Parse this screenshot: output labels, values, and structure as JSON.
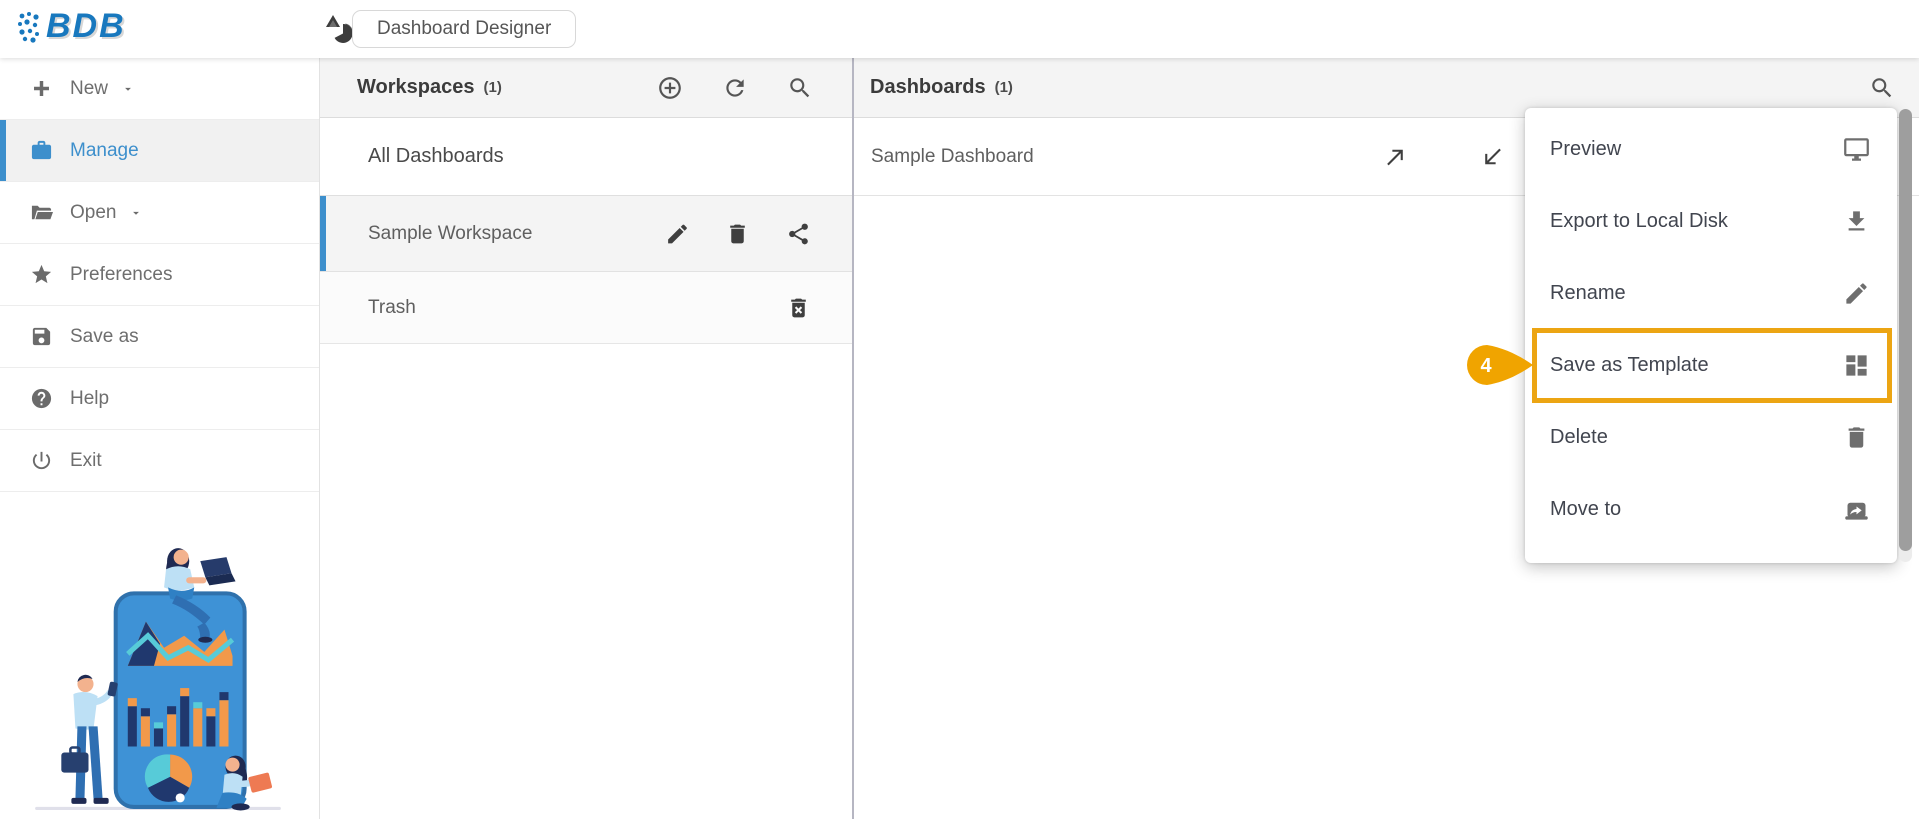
{
  "topbar": {
    "logo_text": "BDB",
    "app_title": "Dashboard Designer"
  },
  "sidebar": {
    "items": [
      {
        "label": "New",
        "has_dropdown": true,
        "active": false
      },
      {
        "label": "Manage",
        "has_dropdown": false,
        "active": true
      },
      {
        "label": "Open",
        "has_dropdown": true,
        "active": false
      },
      {
        "label": "Preferences",
        "has_dropdown": false,
        "active": false
      },
      {
        "label": "Save as",
        "has_dropdown": false,
        "active": false
      },
      {
        "label": "Help",
        "has_dropdown": false,
        "active": false
      },
      {
        "label": "Exit",
        "has_dropdown": false,
        "active": false
      }
    ]
  },
  "workspaces": {
    "title": "Workspaces",
    "count": "(1)",
    "header_icons": [
      "add-circle",
      "refresh",
      "search"
    ],
    "items": [
      {
        "label": "All Dashboards",
        "selected": false
      },
      {
        "label": "Sample Workspace",
        "selected": true,
        "actions": [
          "edit",
          "delete",
          "share"
        ]
      },
      {
        "label": "Trash",
        "selected": false,
        "actions": [
          "delete-forever"
        ]
      }
    ]
  },
  "dashboards": {
    "title": "Dashboards",
    "count": "(1)",
    "header_icons": [
      "search"
    ],
    "items": [
      {
        "label": "Sample Dashboard",
        "actions": [
          "open-in-new",
          "open-in-current"
        ]
      }
    ]
  },
  "context_menu": {
    "items": [
      {
        "label": "Preview",
        "icon": "monitor"
      },
      {
        "label": "Export to Local Disk",
        "icon": "download"
      },
      {
        "label": "Rename",
        "icon": "pencil"
      },
      {
        "label": "Save as Template",
        "icon": "dashboard-grid",
        "highlighted": true
      },
      {
        "label": "Delete",
        "icon": "trash"
      },
      {
        "label": "Move to",
        "icon": "move"
      }
    ]
  },
  "annotation": {
    "step_number": "4"
  },
  "colors": {
    "accent_blue": "#3D8FCC",
    "logo_blue": "#1878BE",
    "highlight_orange": "#ECA513",
    "panel_header_bg": "#F4F4F4",
    "icon_gray": "#6B6B6B",
    "scrollbar_thumb": "#9E9E9E"
  }
}
